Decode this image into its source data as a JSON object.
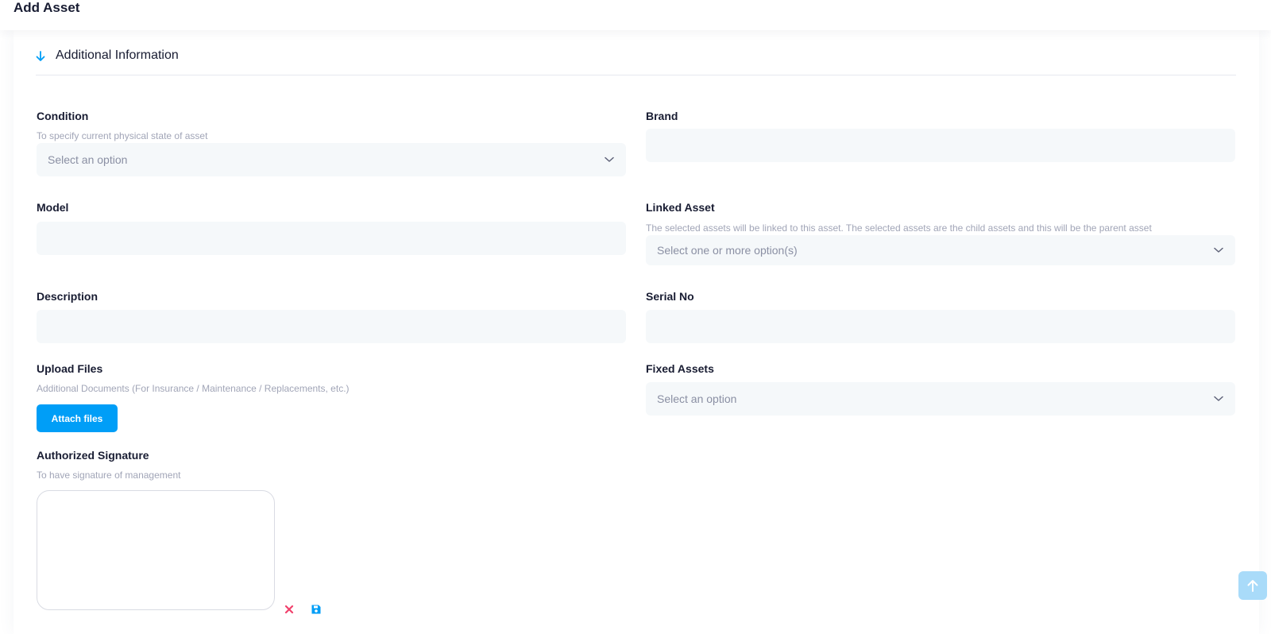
{
  "header": {
    "title": "Add Asset"
  },
  "section": {
    "title": "Additional Information"
  },
  "condition": {
    "label": "Condition",
    "hint": "To specify current physical state of asset",
    "placeholder": "Select an option"
  },
  "brand": {
    "label": "Brand",
    "value": ""
  },
  "model": {
    "label": "Model",
    "value": ""
  },
  "linked_asset": {
    "label": "Linked Asset",
    "hint": "The selected assets will be linked to this asset. The selected assets are the child assets and this will be the parent asset",
    "placeholder": "Select one or more option(s)"
  },
  "description": {
    "label": "Description",
    "value": ""
  },
  "serial_no": {
    "label": "Serial No",
    "value": ""
  },
  "upload": {
    "label": "Upload Files",
    "hint": "Additional Documents (For Insurance / Maintenance / Replacements, etc.)",
    "button_label": "Attach files"
  },
  "fixed_assets": {
    "label": "Fixed Assets",
    "placeholder": "Select an option"
  },
  "signature": {
    "label": "Authorized Signature",
    "hint": "To have signature of management"
  },
  "icons": {
    "section_toggle": "arrow-down-icon",
    "dropdown": "chevron-down-icon",
    "clear_signature": "close-icon",
    "save_signature": "save-icon",
    "scroll_top": "arrow-up-icon"
  },
  "colors": {
    "accent": "#009ef7",
    "field_bg": "#f5f8fa",
    "clear_red": "#f1416c",
    "scroll_top_bg": "#a9dbf9"
  }
}
